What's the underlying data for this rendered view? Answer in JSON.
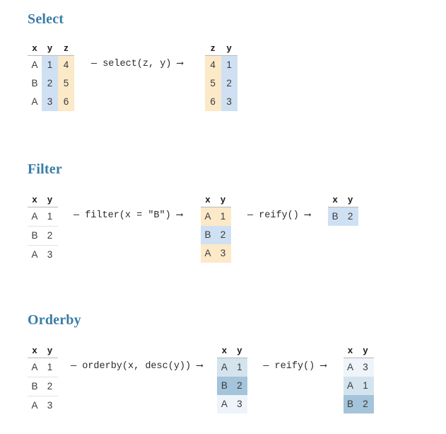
{
  "page": {
    "background": "#ffffff",
    "heading_color": "#3a7ca8",
    "fill_blue": "#cfe0f3",
    "fill_orange": "#fce9c8",
    "fill_blue_light": "#eef4fa",
    "fill_blue_medium": "#d3e4ee",
    "fill_blue_dark": "#a3c4da"
  },
  "sections": [
    {
      "id": "select",
      "title": "Select",
      "tables": [
        {
          "id": "select-input",
          "headers": [
            "x",
            "y",
            "z"
          ],
          "rows": [
            [
              "A",
              "1",
              "4"
            ],
            [
              "B",
              "2",
              "5"
            ],
            [
              "A",
              "3",
              "6"
            ]
          ]
        },
        {
          "id": "select-output",
          "headers": [
            "z",
            "y"
          ],
          "rows": [
            [
              "4",
              "1"
            ],
            [
              "5",
              "2"
            ],
            [
              "6",
              "3"
            ]
          ]
        }
      ],
      "arrows": [
        {
          "id": "select-arrow",
          "label": "— select(z, y) ⟶"
        }
      ]
    },
    {
      "id": "filter",
      "title": "Filter",
      "tables": [
        {
          "id": "filter-input",
          "headers": [
            "x",
            "y"
          ],
          "rows": [
            [
              "A",
              "1"
            ],
            [
              "B",
              "2"
            ],
            [
              "A",
              "3"
            ]
          ]
        },
        {
          "id": "filter-masked",
          "headers": [
            "x",
            "y"
          ],
          "rows": [
            [
              "A",
              "1"
            ],
            [
              "B",
              "2"
            ],
            [
              "A",
              "3"
            ]
          ]
        },
        {
          "id": "filter-reified",
          "headers": [
            "x",
            "y"
          ],
          "rows": [
            [
              "B",
              "2"
            ]
          ]
        }
      ],
      "arrows": [
        {
          "id": "filter-arrow",
          "label": "— filter(x = \"B\") ⟶"
        },
        {
          "id": "filter-reify-arrow",
          "label": "— reify() ⟶"
        }
      ]
    },
    {
      "id": "orderby",
      "title": "Orderby",
      "tables": [
        {
          "id": "orderby-input",
          "headers": [
            "x",
            "y"
          ],
          "rows": [
            [
              "A",
              "1"
            ],
            [
              "B",
              "2"
            ],
            [
              "A",
              "3"
            ]
          ]
        },
        {
          "id": "orderby-ranked",
          "headers": [
            "x",
            "y"
          ],
          "rows": [
            [
              "A",
              "1"
            ],
            [
              "B",
              "2"
            ],
            [
              "A",
              "3"
            ]
          ]
        },
        {
          "id": "orderby-reified",
          "headers": [
            "x",
            "y"
          ],
          "rows": [
            [
              "A",
              "3"
            ],
            [
              "A",
              "1"
            ],
            [
              "B",
              "2"
            ]
          ]
        }
      ],
      "arrows": [
        {
          "id": "orderby-arrow",
          "label": "— orderby(x, desc(y)) ⟶"
        },
        {
          "id": "orderby-reify-arrow",
          "label": "— reify() ⟶"
        }
      ]
    }
  ]
}
